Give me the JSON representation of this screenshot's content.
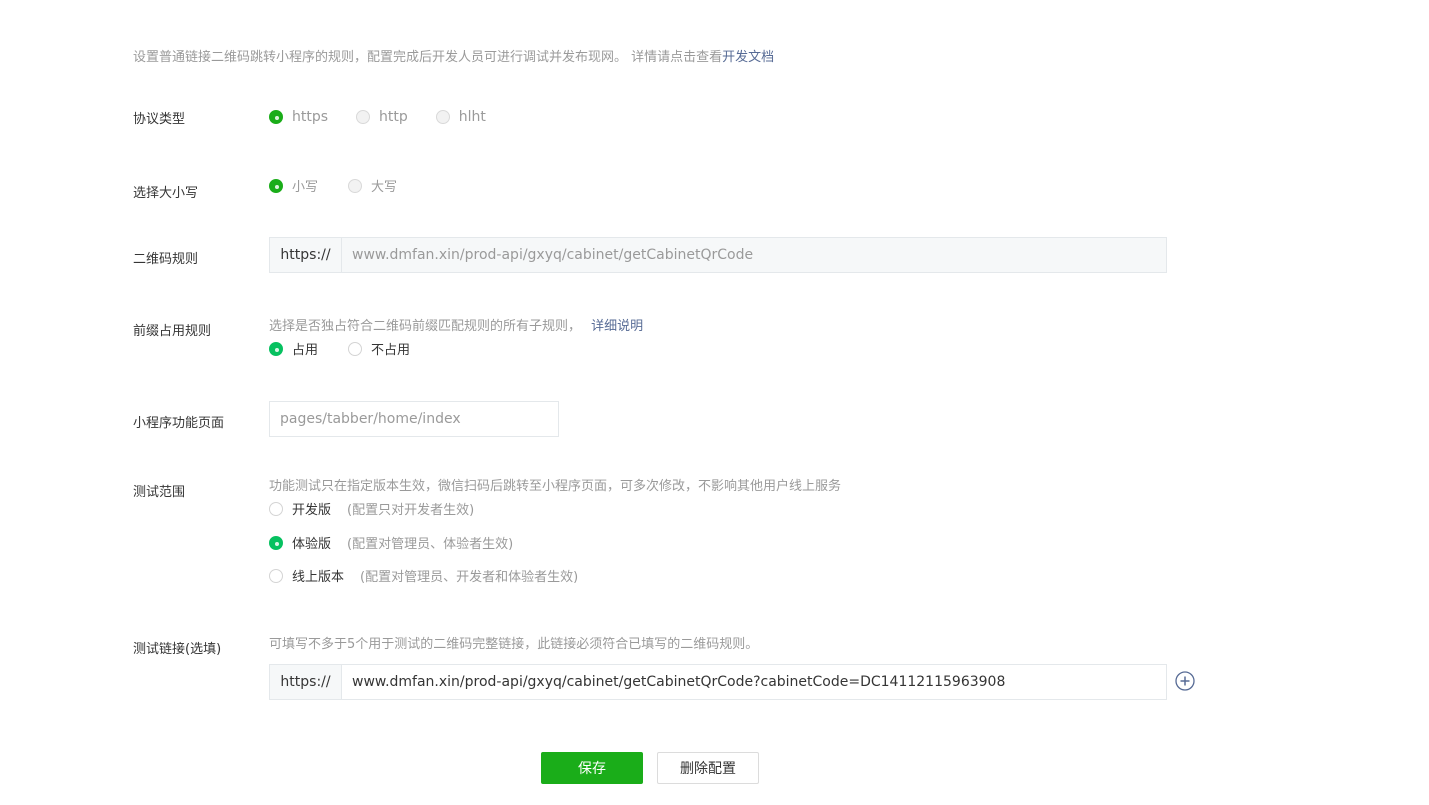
{
  "intro": {
    "text": "设置普通链接二维码跳转小程序的规则，配置完成后开发人员可进行调试并发布现网。 详情请点击查看",
    "link": "开发文档"
  },
  "protocol": {
    "label": "协议类型",
    "options": [
      "https",
      "http",
      "hlht"
    ],
    "selected": "https"
  },
  "case": {
    "label": "选择大小写",
    "options": [
      "小写",
      "大写"
    ],
    "selected": "小写"
  },
  "qr_rule": {
    "label": "二维码规则",
    "prefix": "https://",
    "value": "www.dmfan.xin/prod-api/gxyq/cabinet/getCabinetQrCode"
  },
  "prefix_rule": {
    "label": "前缀占用规则",
    "hint": "选择是否独占符合二维码前缀匹配规则的所有子规则，",
    "link": "详细说明",
    "options": [
      "占用",
      "不占用"
    ],
    "selected": "占用"
  },
  "page": {
    "label": "小程序功能页面",
    "value": "pages/tabber/home/index"
  },
  "test_scope": {
    "label": "测试范围",
    "hint": "功能测试只在指定版本生效，微信扫码后跳转至小程序页面，可多次修改，不影响其他用户线上服务",
    "options": [
      {
        "label": "开发版",
        "note": "(配置只对开发者生效)"
      },
      {
        "label": "体验版",
        "note": "(配置对管理员、体验者生效)"
      },
      {
        "label": "线上版本",
        "note": "(配置对管理员、开发者和体验者生效)"
      }
    ],
    "selected": "体验版"
  },
  "test_link": {
    "label": "测试链接(选填)",
    "hint": "可填写不多于5个用于测试的二维码完整链接，此链接必须符合已填写的二维码规则。",
    "prefix": "https://",
    "value": "www.dmfan.xin/prod-api/gxyq/cabinet/getCabinetQrCode?cabinetCode=DC14112115963908"
  },
  "buttons": {
    "save": "保存",
    "delete": "删除配置"
  },
  "colors": {
    "brand_green": "#1aad19",
    "link_blue": "#576b95"
  }
}
